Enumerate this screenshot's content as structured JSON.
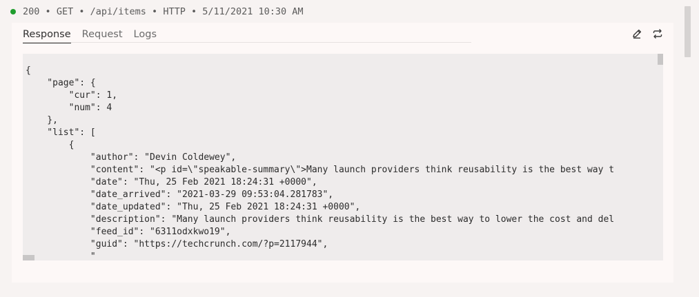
{
  "status": {
    "code": "200",
    "method": "GET",
    "path": "/api/items",
    "protocol": "HTTP",
    "timestamp": "5/11/2021 10:30 AM",
    "separator": "•",
    "dot_color": "#1f9d2d"
  },
  "tabs": [
    {
      "label": "Response",
      "active": true
    },
    {
      "label": "Request",
      "active": false
    },
    {
      "label": "Logs",
      "active": false
    }
  ],
  "toolbar": {
    "edit_icon": "pencil-icon",
    "repeat_icon": "repeat-arrows-icon"
  },
  "response_body": {
    "lines": [
      "{",
      "    \"page\": {",
      "        \"cur\": 1,",
      "        \"num\": 4",
      "    },",
      "    \"list\": [",
      "        {",
      "            \"author\": \"Devin Coldewey\",",
      "            \"content\": \"<p id=\\\"speakable-summary\\\">Many launch providers think reusability is the best way t",
      "            \"date\": \"Thu, 25 Feb 2021 18:24:31 +0000\",",
      "            \"date_arrived\": \"2021-03-29 09:53:04.281783\",",
      "            \"date_updated\": \"Thu, 25 Feb 2021 18:24:31 +0000\",",
      "            \"description\": \"Many launch providers think reusability is the best way to lower the cost and del",
      "            \"feed_id\": \"6311odxkwo19\",",
      "            \"guid\": \"https://techcrunch.com/?p=2117944\",",
      "            \""
    ]
  }
}
